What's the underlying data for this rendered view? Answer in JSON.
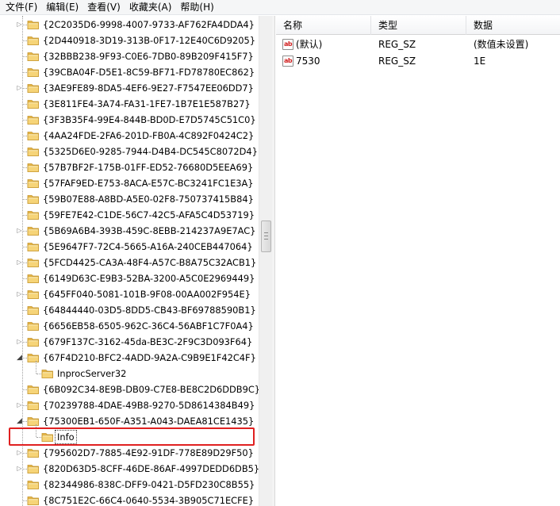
{
  "menu": [
    {
      "label": "文件(F)"
    },
    {
      "label": "编辑(E)"
    },
    {
      "label": "查看(V)"
    },
    {
      "label": "收藏夹(A)"
    },
    {
      "label": "帮助(H)"
    }
  ],
  "tree": {
    "rows": [
      {
        "label": "{2C2035D6-9998-4007-9733-AF762FA4DDA4}",
        "expander": "collapsed"
      },
      {
        "label": "{2D440918-3D19-313B-0F17-12E40C6D9205}",
        "expander": "none"
      },
      {
        "label": "{32BBB238-9F93-C0E6-7DB0-89B209F415F7}",
        "expander": "none"
      },
      {
        "label": "{39CBA04F-D5E1-8C59-BF71-FD78780EC862}",
        "expander": "none"
      },
      {
        "label": "{3AE9FE89-8DA5-4EF6-9E27-F7547EE06DD7}",
        "expander": "collapsed"
      },
      {
        "label": "{3E811FE4-3A74-FA31-1FE7-1B7E1E587B27}",
        "expander": "none"
      },
      {
        "label": "{3F3B35F4-99E4-844B-BD0D-E7D5745C51C0}",
        "expander": "none"
      },
      {
        "label": "{4AA24FDE-2FA6-201D-FB0A-4C892F0424C2}",
        "expander": "none"
      },
      {
        "label": "{5325D6E0-9285-7944-D4B4-DC545C8072D4}",
        "expander": "none"
      },
      {
        "label": "{57B7BF2F-175B-01FF-ED52-76680D5EEA69}",
        "expander": "none"
      },
      {
        "label": "{57FAF9ED-E753-8ACA-E57C-BC3241FC1E3A}",
        "expander": "none"
      },
      {
        "label": "{59B07E88-A8BD-A5E0-02F8-750737415B84}",
        "expander": "none"
      },
      {
        "label": "{59FE7E42-C1DE-56C7-42C5-AFA5C4D53719}",
        "expander": "none"
      },
      {
        "label": "{5B69A6B4-393B-459C-8EBB-214237A9E7AC}",
        "expander": "collapsed"
      },
      {
        "label": "{5E9647F7-72C4-5665-A16A-240CEB447064}",
        "expander": "none"
      },
      {
        "label": "{5FCD4425-CA3A-48F4-A57C-B8A75C32ACB1}",
        "expander": "collapsed"
      },
      {
        "label": "{6149D63C-E9B3-52BA-3200-A5C0E2969449}",
        "expander": "none"
      },
      {
        "label": "{645FF040-5081-101B-9F08-00AA002F954E}",
        "expander": "collapsed"
      },
      {
        "label": "{64844440-03D5-8DD5-CB43-BF69788590B1}",
        "expander": "none"
      },
      {
        "label": "{6656EB58-6505-962C-36C4-56ABF1C7F0A4}",
        "expander": "none"
      },
      {
        "label": "{679F137C-3162-45da-BE3C-2F9C3D093F64}",
        "expander": "collapsed"
      },
      {
        "label": "{67F4D210-BFC2-4ADD-9A2A-C9B9E1F42C4F}",
        "expander": "expanded"
      },
      {
        "label": "InprocServer32",
        "expander": "child"
      },
      {
        "label": "{6B092C34-8E9B-DB09-C7E8-BE8C2D6DDB9C}",
        "expander": "none"
      },
      {
        "label": "{70239788-4DAE-49B8-9270-5D8614384B49}",
        "expander": "collapsed"
      },
      {
        "label": "{75300EB1-650F-A351-A043-DAEA81CE1435}",
        "expander": "expanded"
      },
      {
        "label": "Info",
        "expander": "child",
        "selected": true
      },
      {
        "label": "{795602D7-7885-4E92-91DF-778E89D29F50}",
        "expander": "collapsed"
      },
      {
        "label": "{820D63D5-8CFF-46DE-86AF-4997DEDD6DB5}",
        "expander": "collapsed"
      },
      {
        "label": "{82344986-838C-DFF9-0421-D5FD230C8B55}",
        "expander": "none"
      },
      {
        "label": "{8C751E2C-66C4-0640-5534-3B905C71ECFE}",
        "expander": "none"
      }
    ]
  },
  "values_pane": {
    "columns": [
      {
        "label": "名称"
      },
      {
        "label": "类型"
      },
      {
        "label": "数据"
      }
    ],
    "rows": [
      {
        "icon": "string-value-icon",
        "name": "(默认)",
        "type": "REG_SZ",
        "data": "(数值未设置)"
      },
      {
        "icon": "string-value-icon",
        "name": "7530",
        "type": "REG_SZ",
        "data": "1E"
      }
    ]
  },
  "colors": {
    "highlight_box": "#e02020",
    "folder_yellow": "#f2c75c",
    "string_icon_red": "#d02020"
  }
}
